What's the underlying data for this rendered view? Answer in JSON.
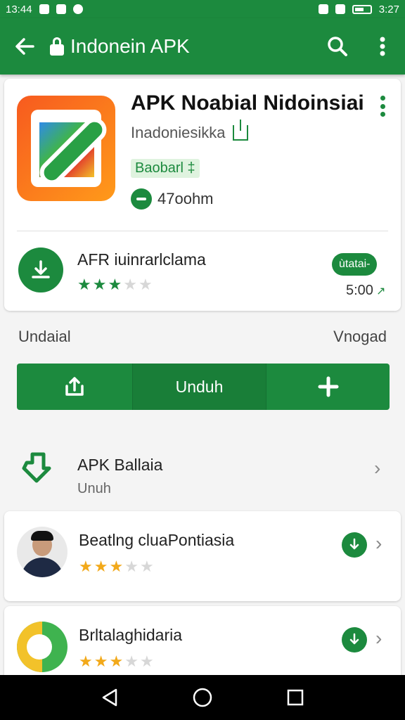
{
  "status_bar": {
    "time": "13:44",
    "right_time": "3:27"
  },
  "app_bar": {
    "title": "Indonein APK"
  },
  "top_card": {
    "app_name": "APK Noabial Nidoinsiai",
    "developer": "Inadoniesikka",
    "badge": "Baobarl ‡",
    "size": "47oohm",
    "row2_title": "AFR iuinrarlclama",
    "row2_pill": "ùtatai-",
    "row2_rating": "5:00",
    "row2_stars": 3
  },
  "section": {
    "left_label": "Undaial",
    "right_label": "Vnogad"
  },
  "action_bar": {
    "center_label": "Unduh"
  },
  "list": {
    "row1": {
      "title": "APK Ballaia",
      "subtitle": "Unuh"
    },
    "card1": {
      "title": "Beatlng cluaPontiasia",
      "stars": 3
    },
    "card2": {
      "title": "Brltalaghidaria",
      "stars": 3
    }
  },
  "colors": {
    "primary": "#1c8a3e",
    "star_gold": "#f2a91a"
  }
}
